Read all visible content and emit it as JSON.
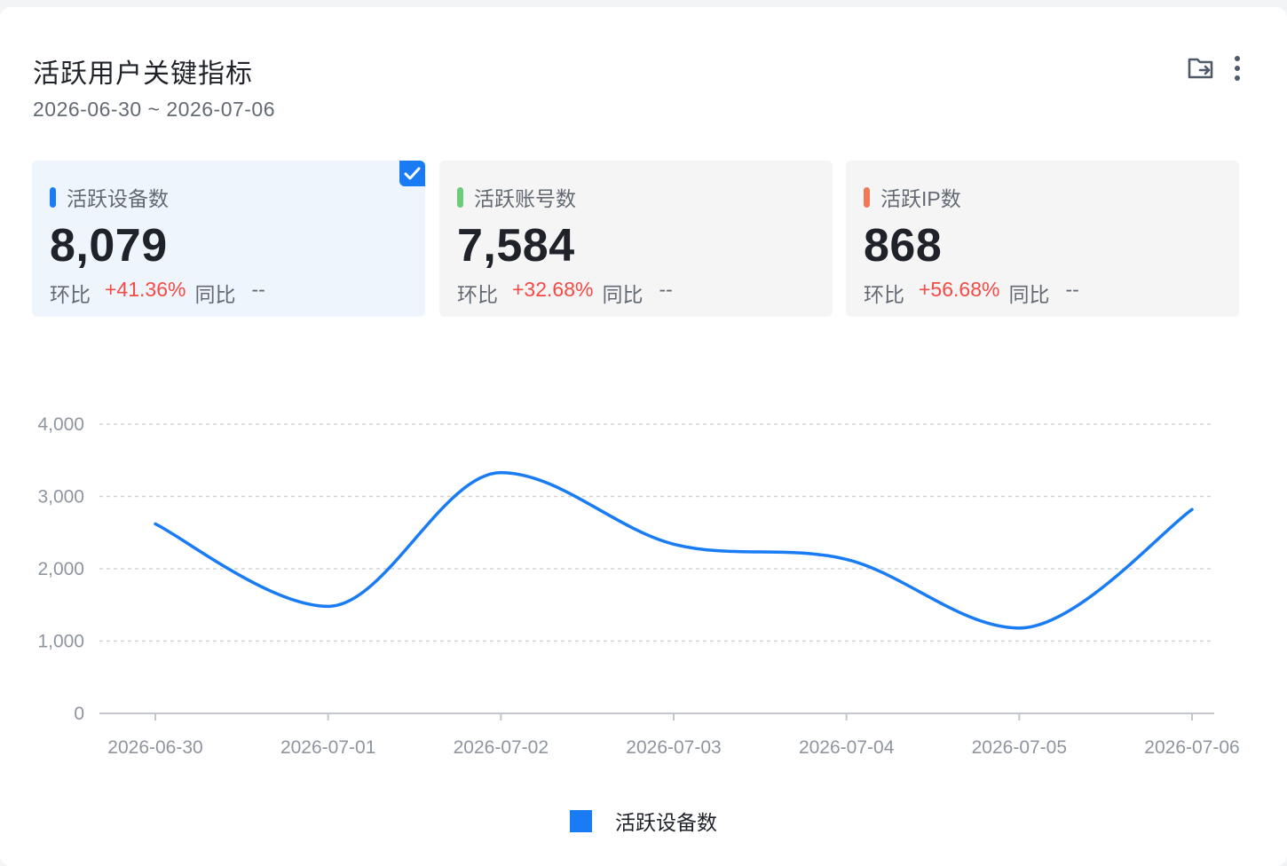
{
  "header": {
    "title": "活跃用户关键指标",
    "date_range": "2026-06-30 ~ 2026-07-06"
  },
  "metrics": [
    {
      "label": "活跃设备数",
      "value": "8,079",
      "mom_label": "环比",
      "mom_value": "+41.36%",
      "yoy_label": "同比",
      "yoy_value": "--",
      "color": "#1a7cf4",
      "selected": true
    },
    {
      "label": "活跃账号数",
      "value": "7,584",
      "mom_label": "环比",
      "mom_value": "+32.68%",
      "yoy_label": "同比",
      "yoy_value": "--",
      "color": "#6ecb7a",
      "selected": false
    },
    {
      "label": "活跃IP数",
      "value": "868",
      "mom_label": "环比",
      "mom_value": "+56.68%",
      "yoy_label": "同比",
      "yoy_value": "--",
      "color": "#f07a55",
      "selected": false
    }
  ],
  "chart_data": {
    "type": "line",
    "smooth": true,
    "categories": [
      "2026-06-30",
      "2026-07-01",
      "2026-07-02",
      "2026-07-03",
      "2026-07-04",
      "2026-07-05",
      "2026-07-06"
    ],
    "y_ticks": [
      "4,000",
      "3,000",
      "2,000",
      "1,000",
      "0"
    ],
    "ylim": [
      0,
      4000
    ],
    "grid": true,
    "legend_position": "bottom",
    "series": [
      {
        "name": "活跃设备数",
        "color": "#1a7cf4",
        "values": [
          2620,
          1480,
          3330,
          2340,
          2130,
          1180,
          2820
        ]
      }
    ]
  },
  "legend": {
    "label": "活跃设备数"
  }
}
